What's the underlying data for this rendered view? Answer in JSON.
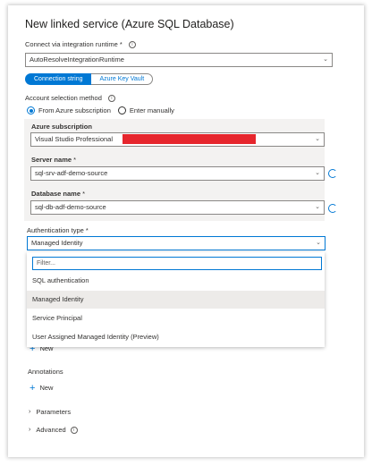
{
  "title": "New linked service (Azure SQL Database)",
  "ir": {
    "label": "Connect via integration runtime",
    "required": "*",
    "value": "AutoResolveIntegrationRuntime"
  },
  "tabs": [
    {
      "label": "Connection string"
    },
    {
      "label": "Azure Key Vault"
    }
  ],
  "account": {
    "label": "Account selection method",
    "options": [
      {
        "label": "From Azure subscription"
      },
      {
        "label": "Enter manually"
      }
    ]
  },
  "subscription": {
    "label": "Azure subscription",
    "value": "Visual Studio Professional"
  },
  "server": {
    "label": "Server name",
    "required": "*",
    "value": "sql-srv-adf-demo-source"
  },
  "database": {
    "label": "Database name",
    "required": "*",
    "value": "sql-db-adf-demo-source"
  },
  "auth": {
    "label": "Authentication type",
    "required": "*",
    "value": "Managed Identity",
    "filter_placeholder": "Filter...",
    "options": [
      {
        "label": "SQL authentication"
      },
      {
        "label": "Managed Identity"
      },
      {
        "label": "Service Principal"
      },
      {
        "label": "User Assigned Managed Identity (Preview)"
      }
    ]
  },
  "new_label": "New",
  "annotations": {
    "label": "Annotations",
    "new_label": "New"
  },
  "parameters": {
    "label": "Parameters"
  },
  "advanced": {
    "label": "Advanced"
  },
  "colors": {
    "accent": "#0078d4",
    "redaction": "#e6262d"
  }
}
